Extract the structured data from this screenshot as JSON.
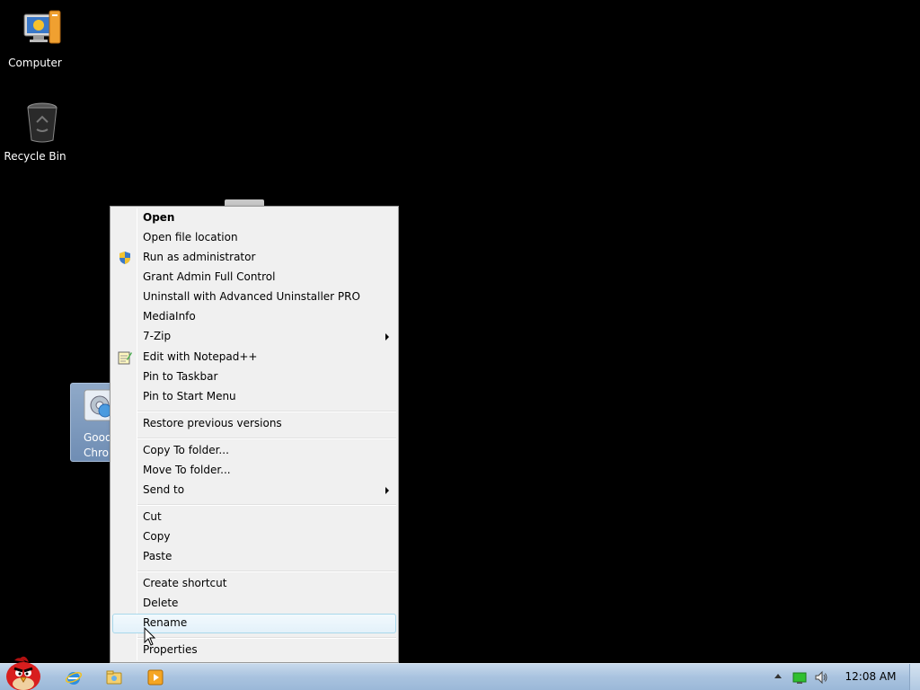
{
  "desktop": {
    "icons": [
      {
        "label": "Computer",
        "icon": "computer-icon"
      },
      {
        "label": "Recycle Bin",
        "icon": "recycle-bin-icon"
      }
    ],
    "selected_icon": {
      "label_line1": "Good",
      "label_line2": "Chro",
      "icon": "gear-shortcut-icon"
    }
  },
  "context_menu": {
    "items": [
      {
        "label": "Open",
        "bold": true
      },
      {
        "label": "Open file location"
      },
      {
        "label": "Run as administrator",
        "icon": "uac-shield-icon"
      },
      {
        "label": "Grant Admin Full Control"
      },
      {
        "label": "Uninstall with Advanced Uninstaller PRO"
      },
      {
        "label": "MediaInfo"
      },
      {
        "label": "7-Zip",
        "submenu": true
      },
      {
        "label": "Edit with Notepad++",
        "icon": "notepad-plus-plus-icon"
      },
      {
        "label": "Pin to Taskbar"
      },
      {
        "label": "Pin to Start Menu"
      },
      {
        "label": "Restore previous versions"
      },
      {
        "label": "Copy To folder..."
      },
      {
        "label": "Move To folder..."
      },
      {
        "label": "Send to",
        "submenu": true
      },
      {
        "label": "Cut"
      },
      {
        "label": "Copy"
      },
      {
        "label": "Paste"
      },
      {
        "label": "Create shortcut"
      },
      {
        "label": "Delete"
      },
      {
        "label": "Rename",
        "highlighted": true
      },
      {
        "label": "Properties"
      }
    ]
  },
  "taskbar": {
    "start": "start-orb-angry-bird-icon",
    "pinned": [
      "internet-explorer-icon",
      "windows-explorer-icon",
      "media-player-icon"
    ],
    "tray": [
      "show-hidden-icons-arrow",
      "network-icon",
      "volume-icon"
    ],
    "clock": "12:08 AM"
  },
  "colors": {
    "menu_bg": "#f0f0f0",
    "taskbar": "#a9c3df",
    "highlight_border": "#a8d8eb",
    "selection": "#7d98bd"
  }
}
